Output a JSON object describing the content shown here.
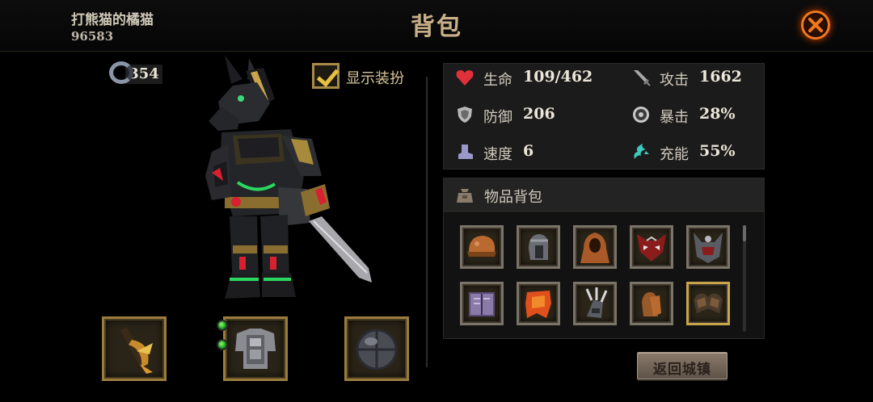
{
  "player": {
    "name": "打熊猫的橘猫",
    "id": "96583"
  },
  "page_title": "背包",
  "close_icon": "close-x-icon",
  "currency": {
    "icon": "ring-icon",
    "value": "354"
  },
  "costume_toggle": {
    "label": "显示装扮",
    "checked": true
  },
  "equipment": [
    {
      "slot": "weapon",
      "icon": "curved-blade-icon"
    },
    {
      "slot": "armor",
      "icon": "plate-armor-icon",
      "gems": 2
    },
    {
      "slot": "helmet",
      "icon": "iron-helmet-icon"
    }
  ],
  "stats": [
    {
      "icon": "heart-icon",
      "label": "生命",
      "value": "109/462",
      "color": "#e0303a"
    },
    {
      "icon": "sword-icon",
      "label": "攻击",
      "value": "1662",
      "color": "#a8a8a8"
    },
    {
      "icon": "shield-icon",
      "label": "防御",
      "value": "206",
      "color": "#b8b8b8"
    },
    {
      "icon": "crit-icon",
      "label": "暴击",
      "value": "28%",
      "color": "#c8c8c8"
    },
    {
      "icon": "boot-icon",
      "label": "速度",
      "value": "6",
      "color": "#9a98c8"
    },
    {
      "icon": "energy-icon",
      "label": "充能",
      "value": "55%",
      "color": "#40c8c0"
    }
  ],
  "inventory": {
    "title": "物品背包",
    "icon": "bag-icon",
    "items": [
      {
        "icon": "leather-cap-icon",
        "selected": false
      },
      {
        "icon": "steel-helm-icon",
        "selected": false
      },
      {
        "icon": "hood-cloak-icon",
        "selected": false
      },
      {
        "icon": "demon-mask-icon",
        "selected": false
      },
      {
        "icon": "horned-helm-icon",
        "selected": false
      },
      {
        "icon": "spellbook-icon",
        "selected": false
      },
      {
        "icon": "fire-cape-icon",
        "selected": false
      },
      {
        "icon": "claw-gauntlet-icon",
        "selected": false
      },
      {
        "icon": "leather-gloves-icon",
        "selected": false
      },
      {
        "icon": "pauldron-icon",
        "selected": true
      }
    ]
  },
  "return_button": {
    "label": "返回城镇"
  }
}
